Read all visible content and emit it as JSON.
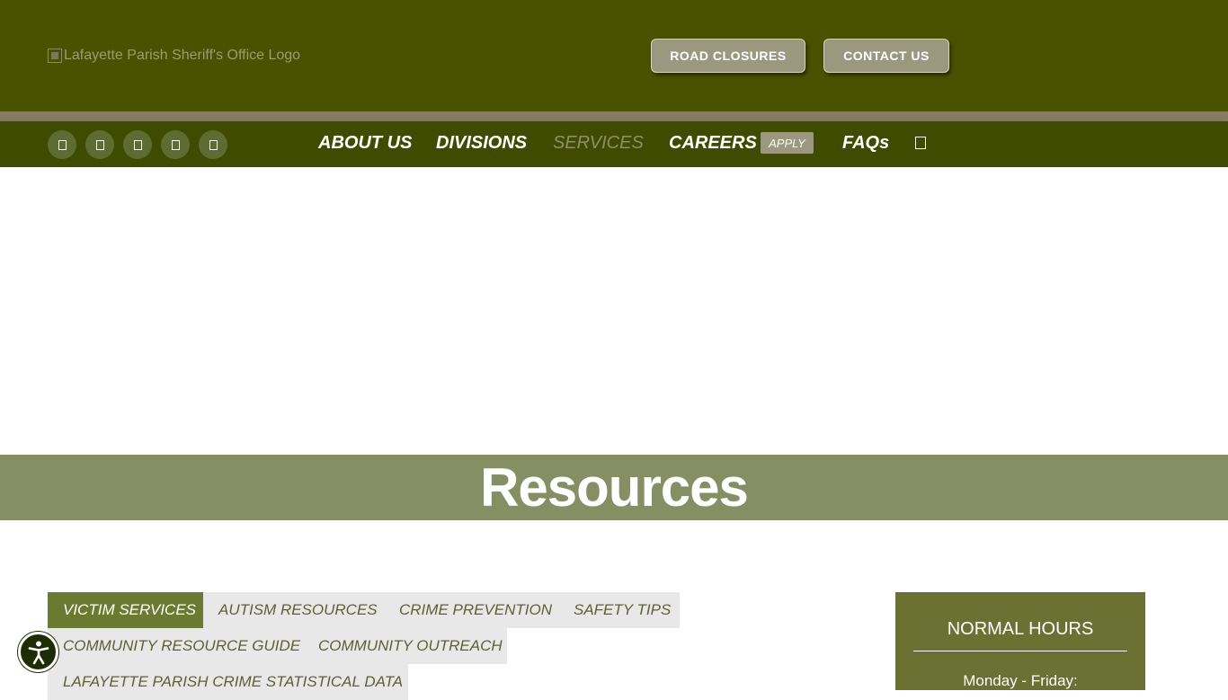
{
  "header": {
    "logo_alt": "Lafayette Parish Sheriff's Office Logo",
    "road_closures_label": "ROAD CLOSURES",
    "contact_us_label": "CONTACT US"
  },
  "nav": {
    "social_icons": [
      "facebook-icon",
      "twitter-icon",
      "instagram-icon",
      "youtube-icon",
      "linkedin-icon"
    ],
    "items": [
      {
        "label": "ABOUT US"
      },
      {
        "label": "DIVISIONS"
      },
      {
        "label": "SERVICES"
      },
      {
        "label": "CAREERS"
      },
      {
        "label": "FAQs"
      }
    ],
    "apply_label": "APPLY",
    "search_icon": "search-icon"
  },
  "page": {
    "title": "Resources"
  },
  "tabs": [
    {
      "label": "VICTIM SERVICES"
    },
    {
      "label": "AUTISM RESOURCES"
    },
    {
      "label": "CRIME PREVENTION"
    },
    {
      "label": "SAFETY TIPS"
    },
    {
      "label": "COMMUNITY RESOURCE GUIDE"
    },
    {
      "label": "COMMUNITY OUTREACH"
    },
    {
      "label": "LAFAYETTE PARISH CRIME STATISTICAL DATA"
    }
  ],
  "hours": {
    "title": "NORMAL HOURS",
    "line1": "Monday - Friday:"
  },
  "colors": {
    "header_bg": "#4a5200",
    "nav_bg": "#3f4c00",
    "accent_tan": "#9c9880",
    "title_band": "#858f63",
    "tab_selected": "#6c7a31",
    "hours_box": "#6b7033"
  },
  "accessibility": {
    "icon": "accessibility-icon"
  }
}
